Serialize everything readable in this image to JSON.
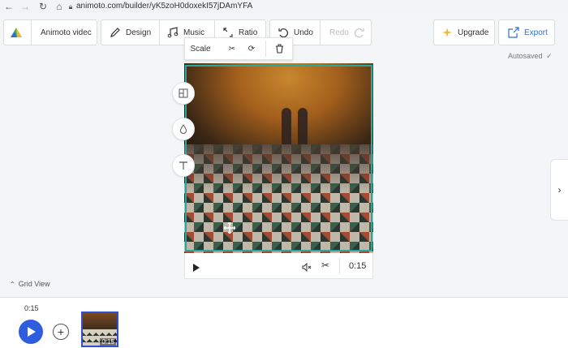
{
  "browser": {
    "url": "animoto.com/builder/yK5zoH0doxekI57jDAmYFA"
  },
  "toolbar": {
    "project_name": "Animoto videc",
    "design_label": "Design",
    "music_label": "Music",
    "ratio_label": "Ratio",
    "undo_label": "Undo",
    "redo_label": "Redo",
    "upgrade_label": "Upgrade",
    "export_label": "Export"
  },
  "status": {
    "autosaved": "Autosaved"
  },
  "block_toolbar": {
    "scale_label": "Scale"
  },
  "player": {
    "duration": "0:15"
  },
  "timeline": {
    "grid_view_label": "Grid View",
    "total_time": "0:15",
    "thumb_duration": "0:15"
  },
  "colors": {
    "accent_teal": "#2aa69b",
    "play_blue": "#2f5de0",
    "export_blue": "#2f6fd6"
  }
}
